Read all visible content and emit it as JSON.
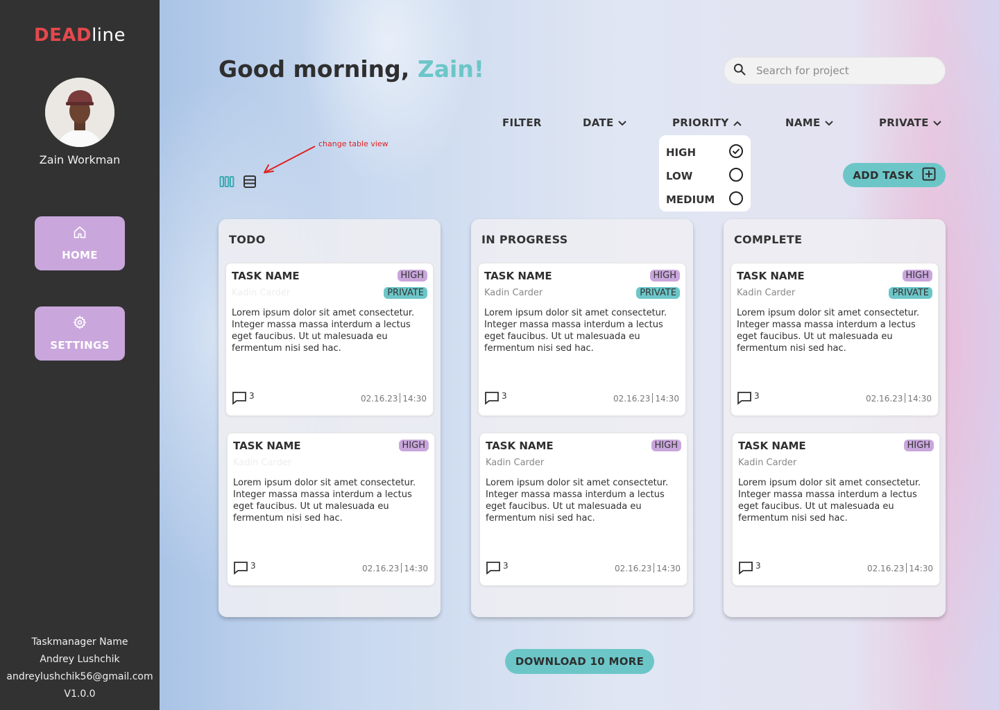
{
  "brand": {
    "part1": "DEAD",
    "part2": "line",
    "accent": "#e5484d"
  },
  "user": {
    "name": "Zain Workman"
  },
  "nav": {
    "home": {
      "label": "HOME",
      "icon": "home-icon"
    },
    "settings": {
      "label": "SETTINGS",
      "icon": "gear-icon"
    }
  },
  "footer": {
    "line1": "Taskmanager Name",
    "line2": "Andrey Lushchik",
    "line3": "andreylushchik56@gmail.com",
    "line4": "V1.0.0"
  },
  "greeting": {
    "prefix": "Good morning, ",
    "name": "Zain!"
  },
  "search": {
    "placeholder": "Search for project",
    "value": ""
  },
  "filters": {
    "filter": "FILTER",
    "date": "DATE",
    "priority": "PRIORITY",
    "name": "NAME",
    "private": "PRIVATE"
  },
  "priority_dropdown": {
    "options": [
      {
        "label": "HIGH",
        "checked": true
      },
      {
        "label": "LOW",
        "checked": false
      },
      {
        "label": "MEDIUM",
        "checked": false
      }
    ]
  },
  "annotation": "change table view",
  "add_task": {
    "label": "ADD TASK"
  },
  "download_more": "DOWNLOAD 10 MORE",
  "colors": {
    "teal": "#6cc6c8",
    "lavender": "#c9a6dc",
    "sidebar": "#323232"
  },
  "columns": [
    {
      "title": "TODO",
      "cards": [
        {
          "title": "TASK NAME",
          "priority": "HIGH",
          "private": "PRIVATE",
          "author": "Kadin Carder",
          "description": "Lorem ipsum dolor sit amet consectetur. Integer massa massa interdum a lectus eget faucibus. Ut ut malesuada eu fermentum nisi sed hac.",
          "comments": "3",
          "date": "02.16.23",
          "time": "14:30"
        },
        {
          "title": "TASK NAME",
          "priority": "HIGH",
          "private": "",
          "author": "Kadin Carder",
          "description": "Lorem ipsum dolor sit amet consectetur. Integer massa massa interdum a lectus eget faucibus. Ut ut malesuada eu fermentum nisi sed hac.",
          "comments": "3",
          "date": "02.16.23",
          "time": "14:30"
        }
      ]
    },
    {
      "title": "IN PROGRESS",
      "cards": [
        {
          "title": "TASK NAME",
          "priority": "HIGH",
          "private": "PRIVATE",
          "author": "Kadin Carder",
          "description": "Lorem ipsum dolor sit amet consectetur. Integer massa massa interdum a lectus eget faucibus. Ut ut malesuada eu fermentum nisi sed hac.",
          "comments": "3",
          "date": "02.16.23",
          "time": "14:30"
        },
        {
          "title": "TASK NAME",
          "priority": "HIGH",
          "private": "",
          "author": "Kadin Carder",
          "description": "Lorem ipsum dolor sit amet consectetur. Integer massa massa interdum a lectus eget faucibus. Ut ut malesuada eu fermentum nisi sed hac.",
          "comments": "3",
          "date": "02.16.23",
          "time": "14:30"
        }
      ]
    },
    {
      "title": "COMPLETE",
      "cards": [
        {
          "title": "TASK NAME",
          "priority": "HIGH",
          "private": "PRIVATE",
          "author": "Kadin Carder",
          "description": "Lorem ipsum dolor sit amet consectetur. Integer massa massa interdum a lectus eget faucibus. Ut ut malesuada eu fermentum nisi sed hac.",
          "comments": "3",
          "date": "02.16.23",
          "time": "14:30"
        },
        {
          "title": "TASK NAME",
          "priority": "HIGH",
          "private": "",
          "author": "Kadin Carder",
          "description": "Lorem ipsum dolor sit amet consectetur. Integer massa massa interdum a lectus eget faucibus. Ut ut malesuada eu fermentum nisi sed hac.",
          "comments": "3",
          "date": "02.16.23",
          "time": "14:30"
        }
      ]
    }
  ]
}
